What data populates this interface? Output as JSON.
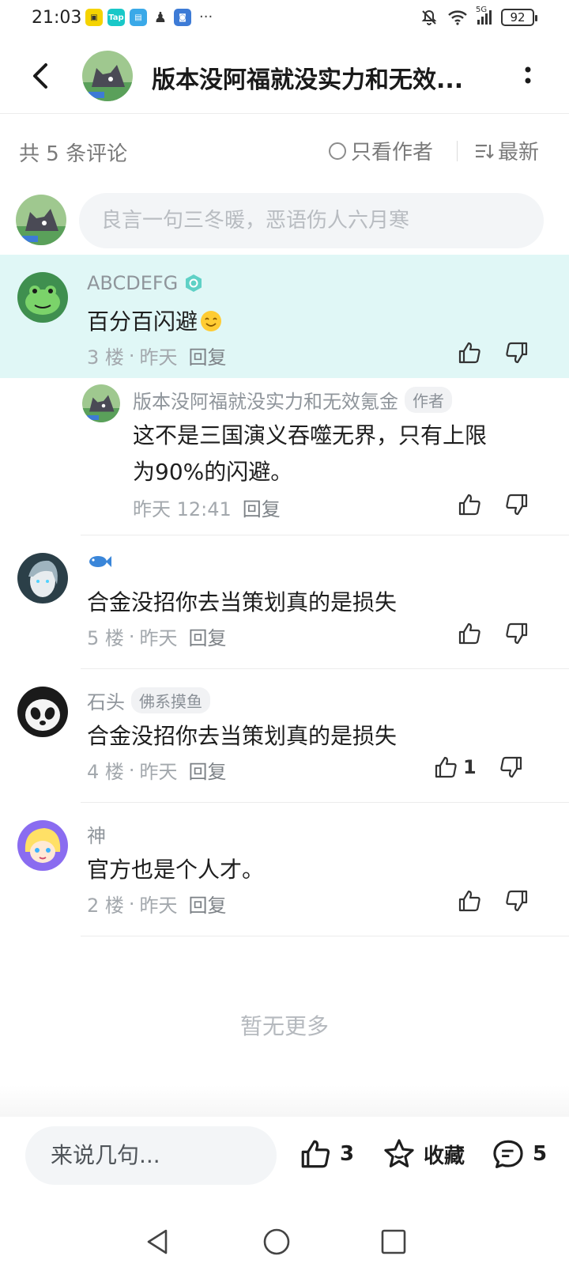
{
  "status_bar": {
    "time": "21:03",
    "network": "5G",
    "battery": "92"
  },
  "header": {
    "title": "版本没阿福就没实力和无效..."
  },
  "filter": {
    "count": "共 5 条评论",
    "author_only": "只看作者",
    "sort": "最新"
  },
  "comment_input": {
    "placeholder": "良言一句三冬暖，恶语伤人六月寒"
  },
  "comments": [
    {
      "name": "ABCDEFG",
      "text": "百分百闪避",
      "floor": "3 楼",
      "time": "昨天",
      "reply": "回复"
    },
    {
      "name": "版本没阿福就没实力和无效氪金",
      "badge": "作者",
      "text_line1": "这不是三国演义吞噬无界，只有上限",
      "text_line2": "为90%的闪避。",
      "time": "昨天 12:41",
      "reply": "回复"
    },
    {
      "name_icon": "fish-icon",
      "text": "合金没招你去当策划真的是损失",
      "floor": "5 楼",
      "time": "昨天",
      "reply": "回复"
    },
    {
      "name": "石头",
      "badge": "佛系摸鱼",
      "text": "合金没招你去当策划真的是损失",
      "floor": "4 楼",
      "time": "昨天",
      "reply": "回复",
      "likes": "1"
    },
    {
      "name": "神",
      "text": "官方也是个人才。",
      "floor": "2 楼",
      "time": "昨天",
      "reply": "回复"
    }
  ],
  "no_more": "暂无更多",
  "bottom_bar": {
    "input_placeholder": "来说几句...",
    "like_count": "3",
    "favorite_label": "收藏",
    "comment_count": "5"
  },
  "colors": {
    "highlight_bg": "#e0f7f6",
    "text_gray": "#8f959b",
    "accent_teal": "#2ec4b6"
  }
}
